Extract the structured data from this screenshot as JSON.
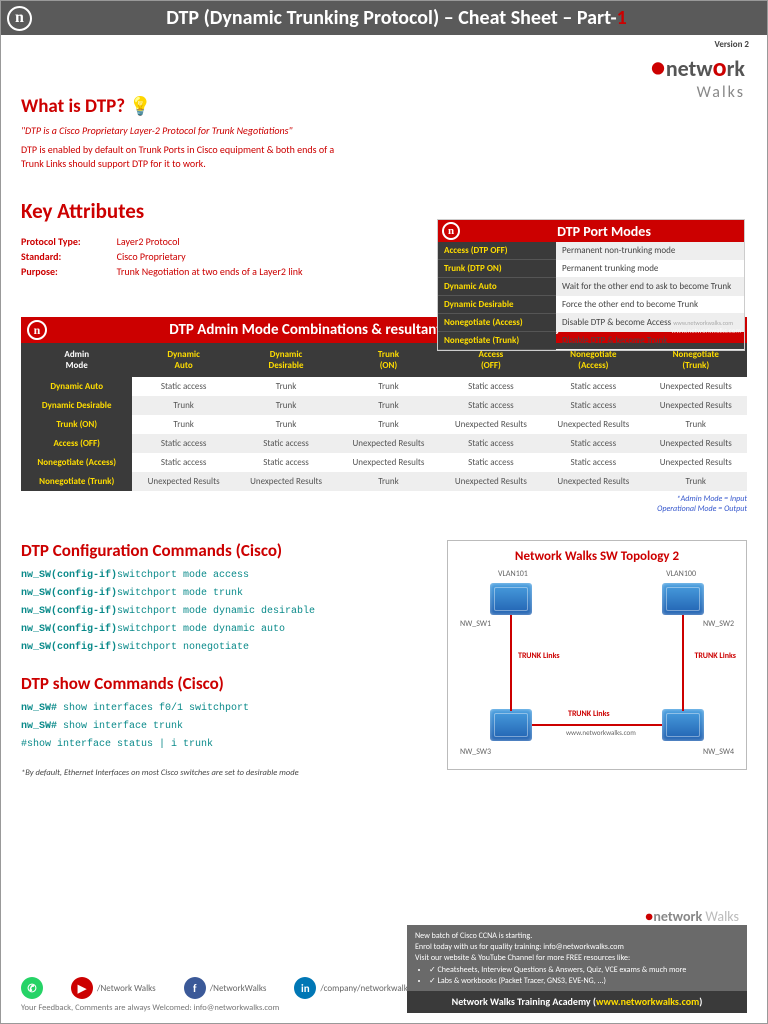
{
  "header": {
    "badge": "n",
    "title_pre": "DTP (Dynamic Trunking Protocol) – Cheat Sheet – Part-",
    "title_num": "1",
    "version": "Version 2"
  },
  "logo": {
    "brand_pre": "netw",
    "brand_o": "o",
    "brand_post": "rk",
    "sub": "Walks"
  },
  "what": {
    "heading": "What is DTP?",
    "quote": "\"DTP is a Cisco Proprietary Layer-2 Protocol for Trunk Negotiations\"",
    "desc": "DTP is enabled by default on Trunk Ports in Cisco equipment & both ends of a Trunk Links should support DTP for it to work."
  },
  "key": {
    "heading": "Key Attributes",
    "rows": [
      {
        "label": "Protocol Type:",
        "value": "Layer2 Protocol"
      },
      {
        "label": "Standard:",
        "value": "Cisco Proprietary"
      },
      {
        "label": "Purpose:",
        "value": "Trunk Negotiation at two ends of a Layer2 link"
      }
    ]
  },
  "portmodes": {
    "title": "DTP Port Modes",
    "rows": [
      {
        "l": "Access (DTP OFF)",
        "r": "Permanent non-trunking mode"
      },
      {
        "l": "Trunk (DTP ON)",
        "r": "Permanent trunking mode"
      },
      {
        "l": "Dynamic Auto",
        "r": "Wait for the other end to ask to become Trunk"
      },
      {
        "l": "Dynamic Desirable",
        "r": "Force the other end to become Trunk"
      },
      {
        "l": "Nonegotiate (Access)",
        "r": "Disable DTP & become Access"
      },
      {
        "l": "Nonegotiate (Trunk)",
        "r": "Disable DTP & become Trunk"
      }
    ],
    "url": "www.networkwalks.com"
  },
  "combos": {
    "title": "DTP Admin Mode Combinations & resultant Operational Mode",
    "url": "www.networkwalks.com",
    "cols": [
      "Admin Mode",
      "Dynamic Auto",
      "Dynamic Desirable",
      "Trunk (ON)",
      "Access (OFF)",
      "Nonegotiate (Access)",
      "Nonegotiate (Trunk)"
    ],
    "rows": [
      [
        "Dynamic Auto",
        "Static access",
        "Trunk",
        "Trunk",
        "Static access",
        "Static access",
        "Unexpected Results"
      ],
      [
        "Dynamic Desirable",
        "Trunk",
        "Trunk",
        "Trunk",
        "Static access",
        "Static access",
        "Unexpected Results"
      ],
      [
        "Trunk (ON)",
        "Trunk",
        "Trunk",
        "Trunk",
        "Unexpected Results",
        "Unexpected Results",
        "Trunk"
      ],
      [
        "Access (OFF)",
        "Static access",
        "Static access",
        "Unexpected Results",
        "Static access",
        "Static access",
        "Unexpected Results"
      ],
      [
        "Nonegotiate (Access)",
        "Static access",
        "Static access",
        "Unexpected Results",
        "Static access",
        "Static access",
        "Unexpected Results"
      ],
      [
        "Nonegotiate (Trunk)",
        "Unexpected Results",
        "Unexpected Results",
        "Trunk",
        "Unexpected Results",
        "Unexpected Results",
        "Trunk"
      ]
    ],
    "legend1": "*Admin Mode = Input",
    "legend2": "Operational Mode = Output"
  },
  "config": {
    "heading": "DTP Configuration Commands (Cisco)",
    "lines": [
      {
        "p": "nw_SW(config-if)",
        "c": "switchport mode access"
      },
      {
        "p": "nw_SW(config-if)",
        "c": "switchport mode trunk"
      },
      {
        "p": "nw_SW(config-if)",
        "c": "switchport mode dynamic desirable"
      },
      {
        "p": "nw_SW(config-if)",
        "c": "switchport mode dynamic auto"
      },
      {
        "p": "nw_SW(config-if)",
        "c": "switchport nonegotiate"
      }
    ]
  },
  "show": {
    "heading": "DTP show Commands (Cisco)",
    "lines": [
      {
        "p": "nw_SW#",
        "c": " show interfaces f0/1 switchport"
      },
      {
        "p": "nw_SW#",
        "c": " show interface trunk"
      },
      {
        "p": "",
        "c": "#show interface status | i trunk"
      }
    ]
  },
  "note": "*By default, Ethernet Interfaces on most Cisco switches are set to desirable mode",
  "topo": {
    "title": "Network Walks SW Topology 2",
    "sw1": "NW_SW1",
    "sw2": "NW_SW2",
    "sw3": "NW_SW3",
    "sw4": "NW_SW4",
    "v1": "VLAN101",
    "v2": "VLAN100",
    "trunk": "TRUNK Links",
    "url": "www.networkwalks.com"
  },
  "socials": {
    "yt": "/Network Walks",
    "fb": "/NetworkWalks",
    "in": "/company/networkwalks"
  },
  "feedback": "Your Feedback, Comments are always Welcomed: info@networkwalks.com",
  "promo": {
    "l1": "New batch of Cisco CCNA is starting.",
    "l2": "Enrol today with us for quality training: info@networkwalks.com",
    "l3": "Visit our website & YouTube Channel for more FREE resources like:",
    "b1": "Cheatsheets, Interview Questions & Answers, Quiz, VCE exams & much more",
    "b2": "Labs & workbooks (Packet Tracer, GNS3, EVE-NG, ...)",
    "acad_pre": "Network Walks Training Academy (",
    "acad_url": "www.networkwalks.com",
    "acad_post": ")"
  }
}
